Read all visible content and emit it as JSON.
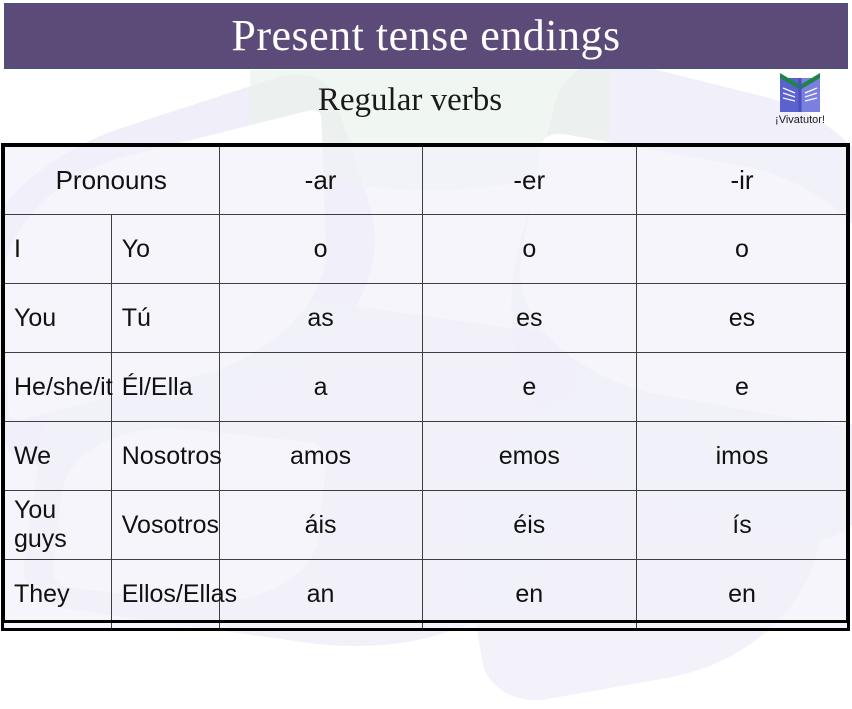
{
  "slide": {
    "title": "Present tense endings",
    "subtitle": "Regular verbs",
    "banner_color": "#5C4B78",
    "banner_border_color": "#41567A",
    "background_color": "#FFFFFF"
  },
  "logo": {
    "icon": "open-book-icon",
    "caption": "¡Vivatutor!",
    "book_page_color": "#6B6FD6",
    "book_top_color": "#1E8449"
  },
  "table": {
    "headers": {
      "pronouns": "Pronouns",
      "ar": "-ar",
      "er": "-er",
      "ir": "-ir"
    },
    "colors": {
      "ar": "#CC0000",
      "er": "#00B050",
      "ir": "#2D5560",
      "cell_bg": "#F1F1FA",
      "border": "#3E3E3E"
    },
    "rows": [
      {
        "english": "I",
        "spanish": "Yo",
        "ar": "o",
        "er": "o",
        "ir": "o"
      },
      {
        "english": "You",
        "spanish": "Tú",
        "ar": "as",
        "er": "es",
        "ir": "es"
      },
      {
        "english": "He/she/it",
        "spanish": "Él/Ella",
        "ar": "a",
        "er": "e",
        "ir": "e"
      },
      {
        "english": "We",
        "spanish": "Nosotros",
        "ar": "amos",
        "er": "emos",
        "ir": "imos"
      },
      {
        "english": "You guys",
        "spanish": "Vosotros",
        "ar": "áis",
        "er": "éis",
        "ir": "ís"
      },
      {
        "english": "They",
        "spanish": "Ellos/Ellas",
        "ar": "an",
        "er": "en",
        "ir": "en"
      }
    ]
  }
}
